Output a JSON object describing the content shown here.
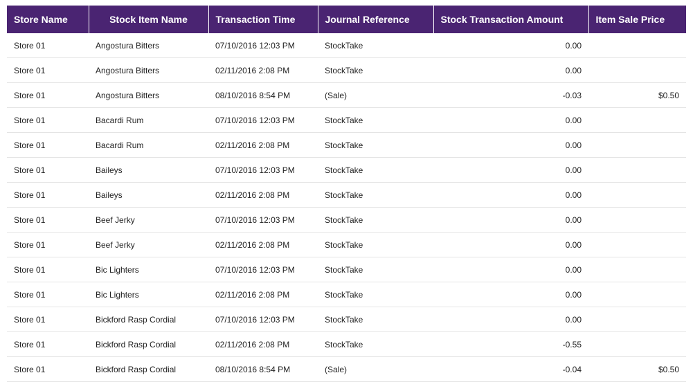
{
  "table": {
    "columns": [
      "Store Name",
      "Stock Item Name",
      "Transaction Time",
      "Journal Reference",
      "Stock Transaction Amount",
      "Item Sale Price"
    ],
    "rows": [
      [
        "Store 01",
        "Angostura Bitters",
        "07/10/2016 12:03 PM",
        "StockTake",
        "0.00",
        ""
      ],
      [
        "Store 01",
        "Angostura Bitters",
        "02/11/2016 2:08 PM",
        "StockTake",
        "0.00",
        ""
      ],
      [
        "Store 01",
        "Angostura Bitters",
        "08/10/2016 8:54 PM",
        "(Sale)",
        "-0.03",
        "$0.50"
      ],
      [
        "Store 01",
        "Bacardi Rum",
        "07/10/2016 12:03 PM",
        "StockTake",
        "0.00",
        ""
      ],
      [
        "Store 01",
        "Bacardi Rum",
        "02/11/2016 2:08 PM",
        "StockTake",
        "0.00",
        ""
      ],
      [
        "Store 01",
        "Baileys",
        "07/10/2016 12:03 PM",
        "StockTake",
        "0.00",
        ""
      ],
      [
        "Store 01",
        "Baileys",
        "02/11/2016 2:08 PM",
        "StockTake",
        "0.00",
        ""
      ],
      [
        "Store 01",
        "Beef Jerky",
        "07/10/2016 12:03 PM",
        "StockTake",
        "0.00",
        ""
      ],
      [
        "Store 01",
        "Beef Jerky",
        "02/11/2016 2:08 PM",
        "StockTake",
        "0.00",
        ""
      ],
      [
        "Store 01",
        "Bic Lighters",
        "07/10/2016 12:03 PM",
        "StockTake",
        "0.00",
        ""
      ],
      [
        "Store 01",
        "Bic Lighters",
        "02/11/2016 2:08 PM",
        "StockTake",
        "0.00",
        ""
      ],
      [
        "Store 01",
        "Bickford Rasp Cordial",
        "07/10/2016 12:03 PM",
        "StockTake",
        "0.00",
        ""
      ],
      [
        "Store 01",
        "Bickford Rasp Cordial",
        "02/11/2016 2:08 PM",
        "StockTake",
        "-0.55",
        ""
      ],
      [
        "Store 01",
        "Bickford Rasp Cordial",
        "08/10/2016 8:54 PM",
        "(Sale)",
        "-0.04",
        "$0.50"
      ]
    ]
  },
  "colors": {
    "header_bg": "#4a2472",
    "header_text": "#ffffff",
    "row_border": "#e4e4e4"
  }
}
